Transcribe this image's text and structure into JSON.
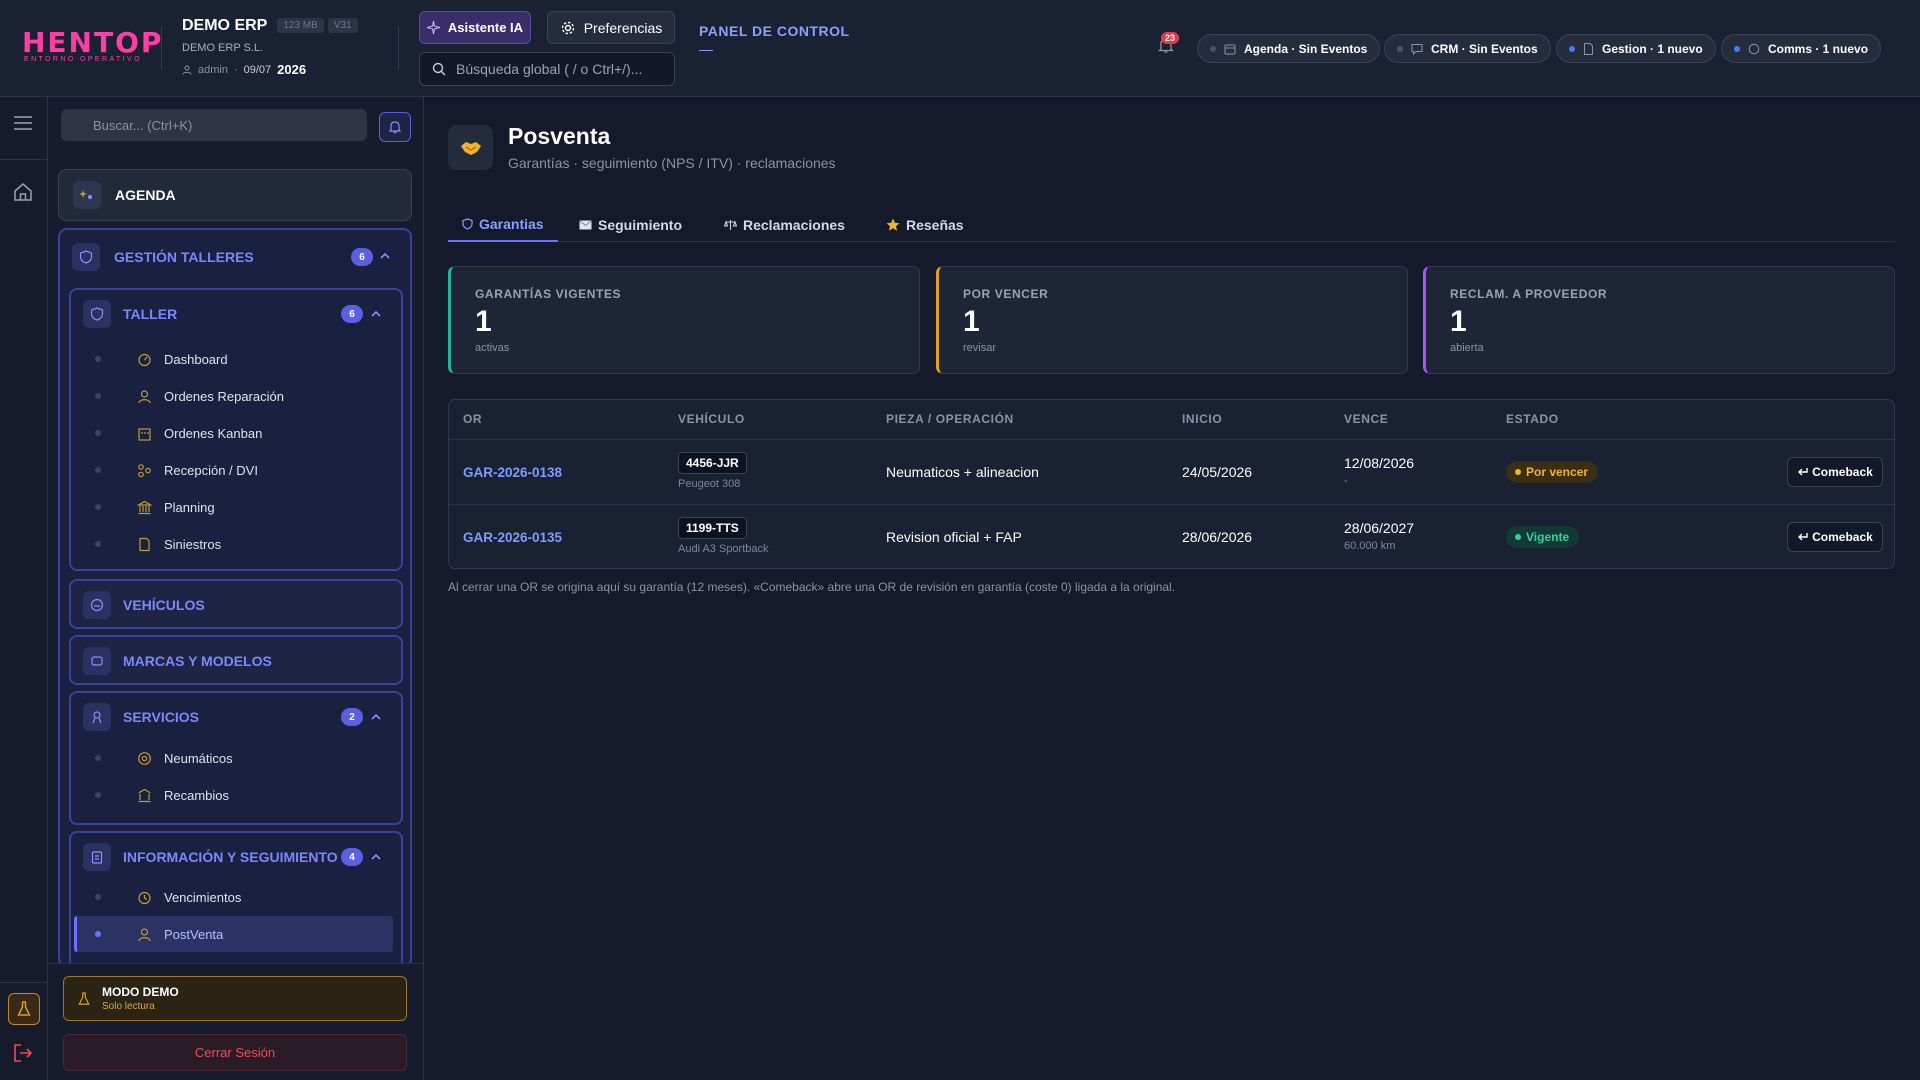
{
  "header": {
    "logo_text": "HENTOP",
    "logo_subtitle": "ENTORNO OPERATIVO",
    "erp_name": "DEMO ERP",
    "mem_chip": "123 MB",
    "version_chip": "V31",
    "company": "DEMO ERP S.L.",
    "user": "admin",
    "date": "09/07",
    "year": "2026",
    "ai_button": "Asistente IA",
    "prefs_button": "Preferencias",
    "search_placeholder": "Búsqueda global ( / o Ctrl+/)...",
    "panel_title": "PANEL DE CONTROL",
    "panel_sub": "—",
    "notification_count": "23",
    "pills": [
      {
        "label": "Agenda · Sin Eventos",
        "dot": "gray"
      },
      {
        "label": "CRM · Sin Eventos",
        "dot": "gray"
      },
      {
        "label": "Gestion · 1 nuevo",
        "dot": "blue"
      },
      {
        "label": "Comms · 1 nuevo",
        "dot": "blue"
      }
    ]
  },
  "sidebar": {
    "search_placeholder": "Buscar... (Ctrl+K)",
    "agenda": "AGENDA",
    "gestion": {
      "label": "GESTIÓN TALLERES",
      "count": "6"
    },
    "taller": {
      "label": "TALLER",
      "count": "6",
      "items": [
        "Dashboard",
        "Ordenes Reparación",
        "Ordenes Kanban",
        "Recepción / DVI",
        "Planning",
        "Siniestros"
      ]
    },
    "vehiculos": "VEHÍCULOS",
    "marcas": "MARCAS Y MODELOS",
    "servicios": {
      "label": "SERVICIOS",
      "count": "2",
      "items": [
        "Neumáticos",
        "Recambios"
      ]
    },
    "info": {
      "label": "INFORMACIÓN Y SEGUIMIENTO",
      "count": "4",
      "items": [
        "Vencimientos",
        "PostVenta"
      ]
    },
    "demo_title": "MODO DEMO",
    "demo_sub": "Solo lectura",
    "logout": "Cerrar Sesión"
  },
  "page": {
    "title": "Posventa",
    "subtitle": "Garantías · seguimiento (NPS / ITV) · reclamaciones",
    "tabs": [
      "Garantias",
      "Seguimiento",
      "Reclamaciones",
      "Reseñas"
    ],
    "kpis": [
      {
        "label": "GARANTÍAS VIGENTES",
        "value": "1",
        "sub": "activas",
        "accent": "#1fb89a"
      },
      {
        "label": "POR VENCER",
        "value": "1",
        "sub": "revisar",
        "accent": "#e0a020"
      },
      {
        "label": "RECLAM. A PROVEEDOR",
        "value": "1",
        "sub": "abierta",
        "accent": "#a855f7"
      }
    ],
    "table": {
      "headers": [
        "OR",
        "VEHÍCULO",
        "PIEZA / OPERACIÓN",
        "INICIO",
        "VENCE",
        "ESTADO"
      ],
      "rows": [
        {
          "or": "GAR-2026-0138",
          "plate": "4456-JJR",
          "model": "Peugeot 308",
          "pieza": "Neumaticos + alineacion",
          "inicio": "24/05/2026",
          "vence": "12/08/2026",
          "vence_sub": "-",
          "estado": "Por vencer",
          "action": "Comeback"
        },
        {
          "or": "GAR-2026-0135",
          "plate": "1199-TTS",
          "model": "Audi A3 Sportback",
          "pieza": "Revision oficial + FAP",
          "inicio": "28/06/2026",
          "vence": "28/06/2027",
          "vence_sub": "60.000 km",
          "estado": "Vigente",
          "action": "Comeback"
        }
      ]
    },
    "footnote": "Al cerrar una OR se origina aquí su garantía (12 meses). «Comeback» abre una OR de revisión en garantía (coste 0) ligada a la original."
  },
  "colors": {
    "accent": "#6b72ff",
    "warning": "#e0a020",
    "success": "#1fb89a",
    "danger": "#ef4a5a"
  }
}
